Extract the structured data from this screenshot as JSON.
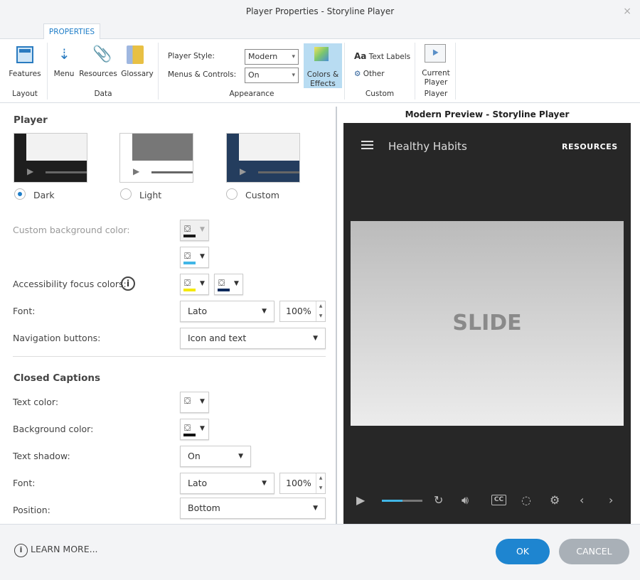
{
  "window": {
    "title": "Player Properties - Storyline Player",
    "close": "×"
  },
  "tab": "PROPERTIES",
  "ribbon": {
    "features": "Features",
    "layout_group": "Layout",
    "menu": "Menu",
    "resources": "Resources",
    "glossary": "Glossary",
    "data_group": "Data",
    "player_style_label": "Player Style:",
    "player_style_value": "Modern",
    "menus_controls_label": "Menus & Controls:",
    "menus_controls_value": "On",
    "colors_effects_1": "Colors &",
    "colors_effects_2": "Effects",
    "appearance_group": "Appearance",
    "text_labels": "Text Labels",
    "text_labels_icon": "Aa",
    "other": "Other",
    "custom_group": "Custom",
    "current_player_1": "Current",
    "current_player_2": "Player",
    "player_group": "Player"
  },
  "player": {
    "heading": "Player",
    "themes": [
      {
        "label": "Dark",
        "selected": true
      },
      {
        "label": "Light",
        "selected": false
      },
      {
        "label": "Custom",
        "selected": false
      }
    ],
    "custom_bg_label": "Custom background color:",
    "colors": {
      "custom_bg": "#1a1a1a",
      "accent": "#41b6e6",
      "focus1": "#f5e900",
      "focus2": "#0d2a5c",
      "cc_text": "#ffffff",
      "cc_bg": "#111111"
    },
    "a11y_label": "Accessibility focus colors:",
    "font_label": "Font:",
    "font_value": "Lato",
    "font_size": "100%",
    "nav_label": "Navigation buttons:",
    "nav_value": "Icon and text"
  },
  "captions": {
    "heading": "Closed Captions",
    "text_color_label": "Text color:",
    "bg_color_label": "Background color:",
    "shadow_label": "Text shadow:",
    "shadow_value": "On",
    "font_label": "Font:",
    "font_value": "Lato",
    "font_size": "100%",
    "position_label": "Position:",
    "position_value": "Bottom"
  },
  "preview": {
    "title": "Modern Preview - Storyline Player",
    "course_title": "Healthy Habits",
    "resources": "RESOURCES",
    "slide": "SLIDE",
    "progress_percent": 50
  },
  "footer": {
    "learn_more": "LEARN MORE...",
    "ok": "OK",
    "cancel": "CANCEL"
  }
}
